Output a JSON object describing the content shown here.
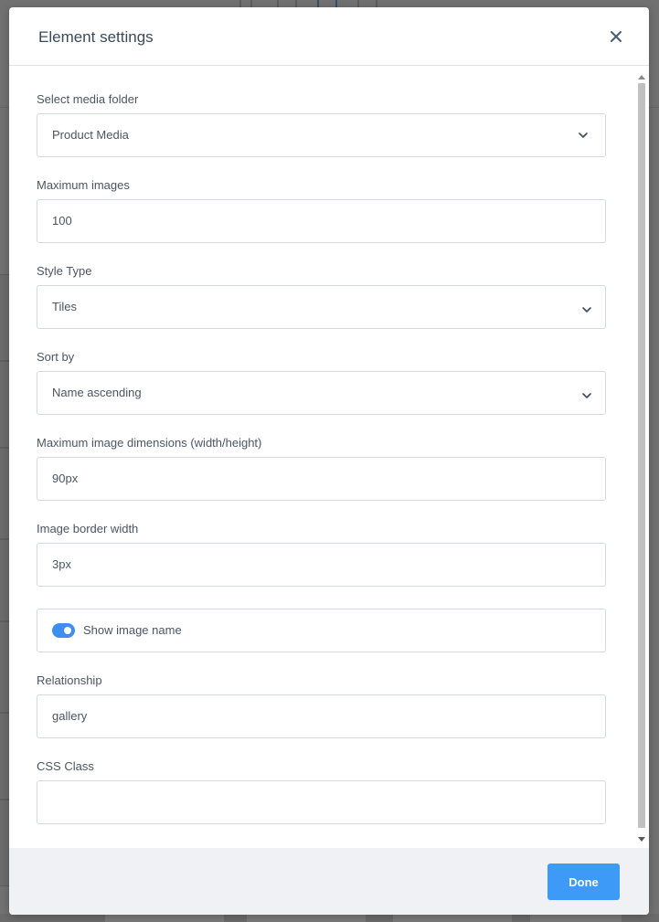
{
  "modal": {
    "title": "Element settings",
    "close_icon": "close-icon",
    "done_label": "Done"
  },
  "fields": {
    "media_folder": {
      "label": "Select media folder",
      "value": "Product Media"
    },
    "max_images": {
      "label": "Maximum images",
      "value": "100"
    },
    "style_type": {
      "label": "Style Type",
      "value": "Tiles"
    },
    "sort_by": {
      "label": "Sort by",
      "value": "Name ascending"
    },
    "max_dimensions": {
      "label": "Maximum image dimensions (width/height)",
      "value": "90px"
    },
    "border_width": {
      "label": "Image border width",
      "value": "3px"
    },
    "show_name": {
      "label": "Show image name",
      "checked": true
    },
    "relationship": {
      "label": "Relationship",
      "value": "gallery"
    },
    "css_class": {
      "label": "CSS Class",
      "value": ""
    }
  },
  "colors": {
    "accent": "#3d9bf7",
    "toggle_on": "#3d8fef",
    "footer_bg": "#f0f1f5",
    "overlay": "#727272"
  }
}
